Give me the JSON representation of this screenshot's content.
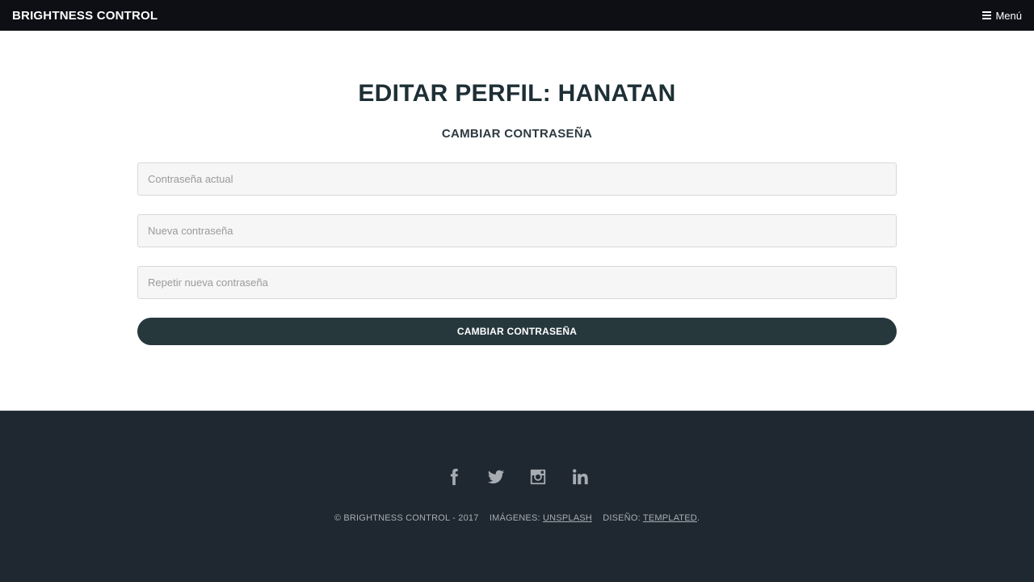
{
  "header": {
    "logo": "BRIGHTNESS CONTROL",
    "menu_label": "Menú"
  },
  "main": {
    "title": "EDITAR PERFIL: HANATAN",
    "subtitle": "CAMBIAR CONTRASEÑA",
    "fields": [
      {
        "placeholder": "Contraseña actual",
        "value": ""
      },
      {
        "placeholder": "Nueva contraseña",
        "value": ""
      },
      {
        "placeholder": "Repetir nueva contraseña",
        "value": ""
      }
    ],
    "submit_label": "CAMBIAR CONTRASEÑA"
  },
  "footer": {
    "social_icons": [
      "facebook-icon",
      "twitter-icon",
      "instagram-icon",
      "linkedin-icon"
    ],
    "copyright": "© BRIGHTNESS CONTROL - 2017",
    "images_label": "IMÁGENES:",
    "images_link": "UNSPLASH",
    "design_label": "DISEÑO:",
    "design_link": "TEMPLATED",
    "design_suffix": "."
  },
  "colors": {
    "header_bg": "#0d0f15",
    "title": "#1e2f36",
    "button_bg": "#27383d",
    "footer_bg": "#1f2831",
    "footer_text": "#a6acb1"
  }
}
